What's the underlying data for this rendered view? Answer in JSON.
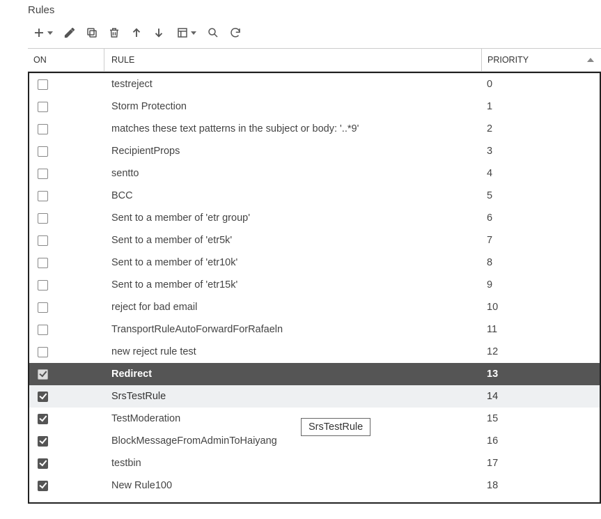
{
  "panel": {
    "title": "Rules"
  },
  "toolbar": {
    "add": "Add",
    "edit": "Edit",
    "copy": "Copy",
    "delete": "Delete",
    "move_up": "Move up",
    "move_down": "Move down",
    "export": "Export",
    "search": "Search",
    "refresh": "Refresh"
  },
  "columns": {
    "on": "ON",
    "rule": "RULE",
    "priority": "PRIORITY"
  },
  "sort": {
    "column": "priority",
    "direction": "asc"
  },
  "tooltip": {
    "text": "SrsTestRule"
  },
  "rows": [
    {
      "on": false,
      "rule": "testreject",
      "priority": "0",
      "state": ""
    },
    {
      "on": false,
      "rule": "Storm Protection",
      "priority": "1",
      "state": ""
    },
    {
      "on": false,
      "rule": "matches these text patterns in the subject or body: '..*9'",
      "priority": "2",
      "state": ""
    },
    {
      "on": false,
      "rule": "RecipientProps",
      "priority": "3",
      "state": ""
    },
    {
      "on": false,
      "rule": "sentto",
      "priority": "4",
      "state": ""
    },
    {
      "on": false,
      "rule": "BCC",
      "priority": "5",
      "state": ""
    },
    {
      "on": false,
      "rule": "Sent to a member of 'etr group'",
      "priority": "6",
      "state": ""
    },
    {
      "on": false,
      "rule": "Sent to a member of 'etr5k'",
      "priority": "7",
      "state": ""
    },
    {
      "on": false,
      "rule": "Sent to a member of 'etr10k'",
      "priority": "8",
      "state": ""
    },
    {
      "on": false,
      "rule": "Sent to a member of 'etr15k'",
      "priority": "9",
      "state": ""
    },
    {
      "on": false,
      "rule": "reject for bad email",
      "priority": "10",
      "state": ""
    },
    {
      "on": false,
      "rule": "TransportRuleAutoForwardForRafaeln",
      "priority": "11",
      "state": ""
    },
    {
      "on": false,
      "rule": "new reject rule test",
      "priority": "12",
      "state": ""
    },
    {
      "on": true,
      "rule": "Redirect",
      "priority": "13",
      "state": "selected"
    },
    {
      "on": true,
      "rule": "SrsTestRule",
      "priority": "14",
      "state": "hover"
    },
    {
      "on": true,
      "rule": "TestModeration",
      "priority": "15",
      "state": ""
    },
    {
      "on": true,
      "rule": "BlockMessageFromAdminToHaiyang",
      "priority": "16",
      "state": ""
    },
    {
      "on": true,
      "rule": "testbin",
      "priority": "17",
      "state": ""
    },
    {
      "on": true,
      "rule": "New Rule100",
      "priority": "18",
      "state": ""
    }
  ]
}
